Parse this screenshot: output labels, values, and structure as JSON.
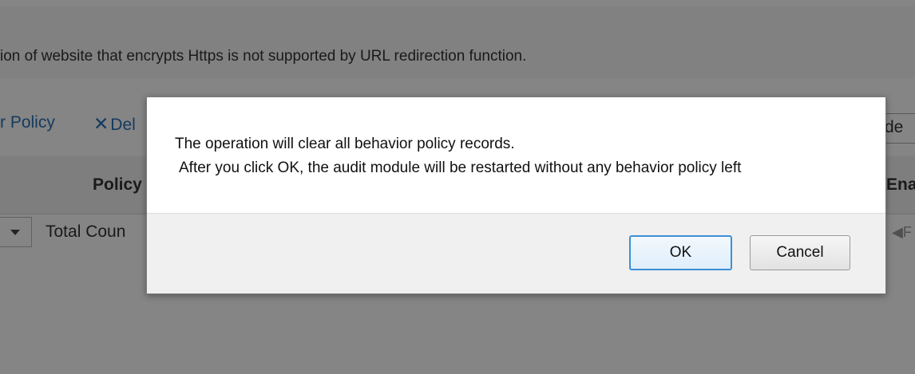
{
  "background": {
    "notice_text": "ion of website that encrypts Https is not supported by URL redirection function.",
    "toolbar": {
      "policy_label": "r Policy",
      "delete_icon": "close-x-icon",
      "delete_label": "Del",
      "right_partial": "de"
    },
    "table": {
      "policy_header": "Policy",
      "enable_header": "Ena"
    },
    "pager": {
      "total_label": "Total Coun",
      "first_label": "◀F"
    }
  },
  "dialog": {
    "message_line1": "The operation will clear all behavior policy records.",
    "message_line2": "After you click OK, the audit module will be restarted without any behavior policy left",
    "ok_label": "OK",
    "cancel_label": "Cancel"
  },
  "colors": {
    "overlay": "#000000",
    "accent_link": "#2a72b5",
    "ok_border": "#3c8fd8"
  }
}
